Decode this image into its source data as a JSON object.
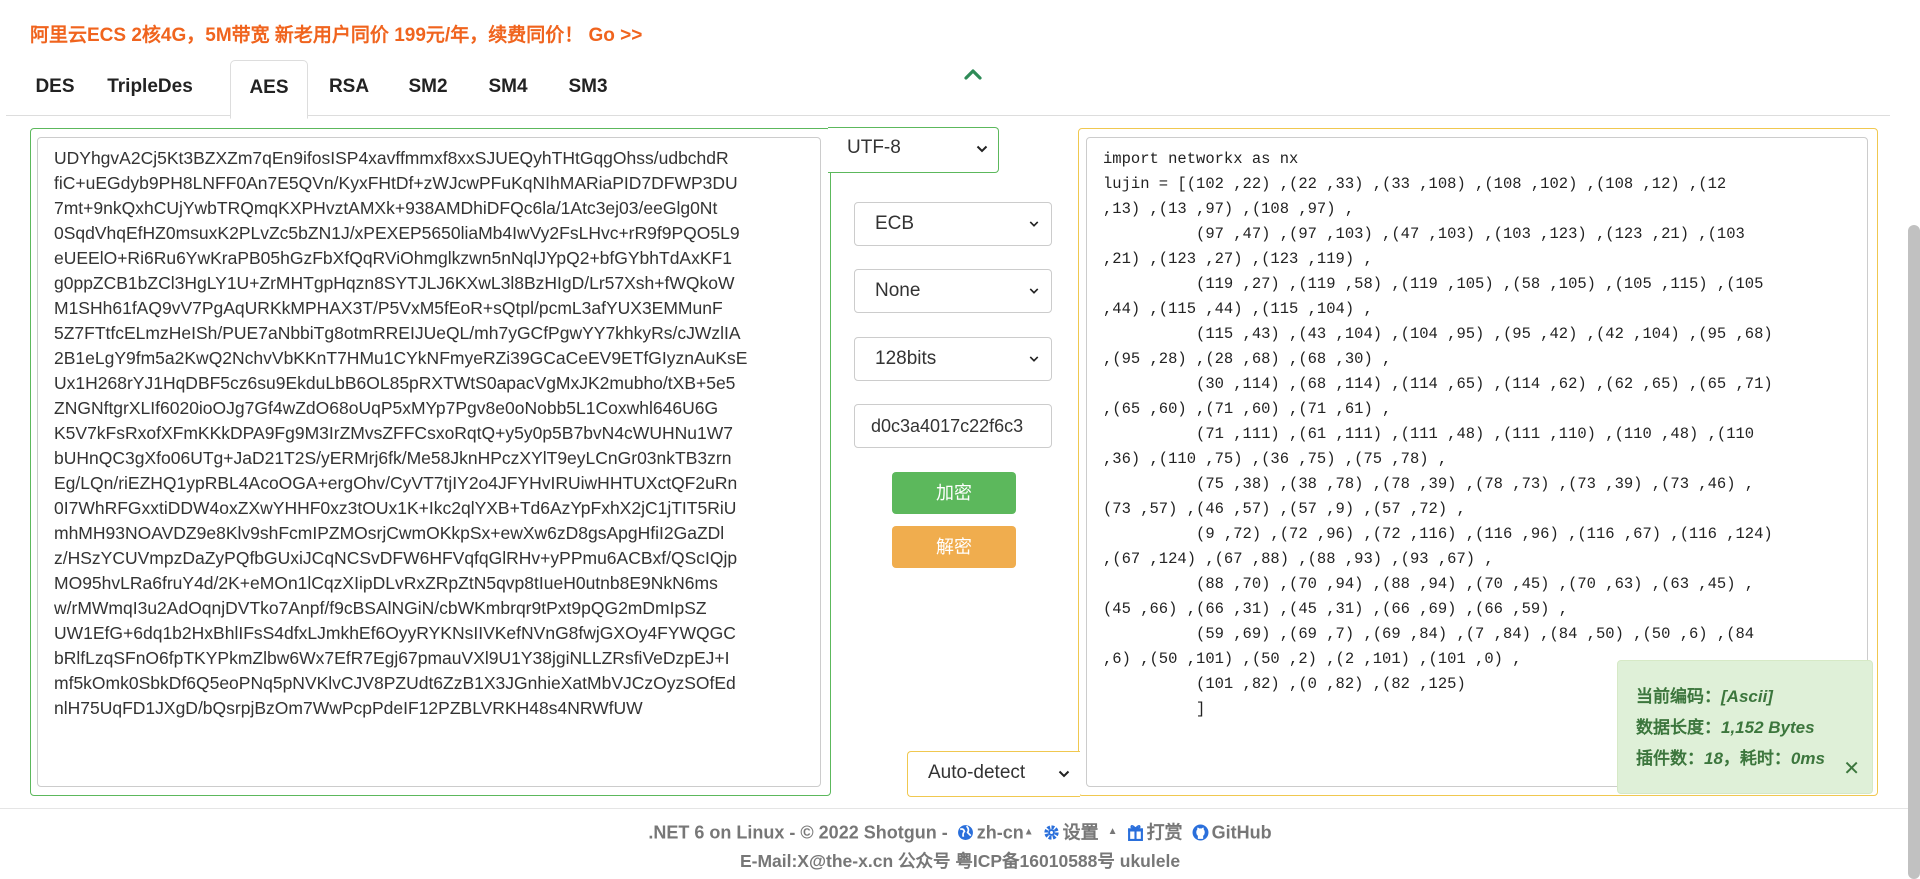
{
  "promo": {
    "text": "阿里云ECS 2核4G，5M带宽 新老用户同价 199元/年，续费同价！ Go >>"
  },
  "tabs": [
    {
      "label": "DES"
    },
    {
      "label": "TripleDes"
    },
    {
      "label": "AES"
    },
    {
      "label": "RSA"
    },
    {
      "label": "SM2"
    },
    {
      "label": "SM4"
    },
    {
      "label": "SM3"
    }
  ],
  "active_tab": "AES",
  "input": {
    "encoding": "UTF-8",
    "lines": [
      "UDYhgvA2Cj5Kt3BZXZm7qEn9ifosISP4xavffmmxf8xxSJUEQyhTHtGqgOhss/udbchdR",
      "fiC+uEGdyb9PH8LNFF0An7E5QVn/KyxFHtDf+zWJcwPFuKqNIhMARiaPID7DFWP3DU",
      "7mt+9nkQxhCUjYwbTRQmqKXPHvztAMXk+938AMDhiDFQc6la/1Atc3ej03/eeGlg0Nt",
      "0SqdVhqEfHZ0msuxK2PLvZc5bZN1J/xPEXEP5650liaMb4IwVy2FsLHvc+rR9f9PQO5L9",
      "eUEElO+Ri6Ru6YwKraPB05hGzFbXfQqRViOhmglkzwn5nNqlJYpQ2+bfGYbhTdAxKF1",
      "g0ppZCB1bZCl3HgLY1U+ZrMHTgpHqzn8SYTJLJ6KXwL3l8BzHIgD/Lr57Xsh+fWQkoW",
      "M1SHh61fAQ9vV7PgAqURKkMPHAX3T/P5VxM5fEoR+sQtpl/pcmL3afYUX3EMMunF",
      "5Z7FTtfcELmzHeISh/PUE7aNbbiTg8otmRREIJUeQL/mh7yGCfPgwYY7khkyRs/cJWzlIA",
      "2B1eLgY9fm5a2KwQ2NchvVbKKnT7HMu1CYkNFmyeRZi39GCaCeEV9ETfGIyznAuKsE",
      "Ux1H268rYJ1HqDBF5cz6su9EkduLbB6OL85pRXTWtS0apacVgMxJK2mubho/tXB+5e5",
      "ZNGNftgrXLIf6020ioOJg7Gf4wZdO68oUqP5xMYp7Pgv8e0oNobb5L1Coxwhl646U6G",
      "K5V7kFsRxofXFmKKkDPA9Fg9M3IrZMvsZFFCsxoRqtQ+y5y0p5B7bvN4cWUHNu1W7",
      "bUHnQC3gXfo06UTg+JaD21T2S/yERMrj6fk/Me58JknHPczXYlT9eyLCnGr03nkTB3zrn",
      "Eg/LQn/riEZHQ1ypRBL4AcoOGA+ergOhv/CyVT7tjIY2o4JFYHvIRUiwHHTUXctQF2uRn",
      "0I7WhRFGxxtiDDW4oxZXwYHHF0xz3tOUx1K+Ikc2qlYXB+Td6AzYpFxhX2jC1jTIT5RiU",
      "mhMH93NOAVDZ9e8Klv9shFcmIPZMOsrjCwmOKkpSx+ewXw6zD8gsApgHfiI2GaZDl",
      "z/HSzYCUVmpzDaZyPQfbGUxiJCqNCSvDFW6HFVqfqGlRHv+yPPmu6ACBxf/QScIQjp",
      "MO95hvLRa6fruY4d/2K+eMOn1lCqzXIipDLvRxZRpZtN5qvp8tIueH0utnb8E9NkN6ms",
      "w/rMWmqI3u2AdOqnjDVTko7Anpf/f9cBSAlNGiN/cbWKmbrqr9tPxt9pQG2mDmIpSZ",
      "UW1EfG+6dq1b2HxBhlIFsS4dfxLJmkhEf6OyyRYKNsIIVKefNVnG8fwjGXOy4FYWQGC",
      "bRlfLzqSFnO6fpTKYPkmZlbw6Wx7EfR7Egj67pmauVXl9U1Y38jgiNLLZRsfiVeDzpEJ+I",
      "mf5kOmk0SbkDf6Q5eoPNq5pNVKlvCJV8PZUdt6ZzB1X3JGnhieXatMbVJCzOyzSOfEd",
      "nlH75UqFD1JXgD/bQsrpjBzOm7WwPcpPdeIF12PZBLVRKH48s4NRWfUW"
    ]
  },
  "controls": {
    "mode": "ECB",
    "padding": "None",
    "keysize": "128bits",
    "key": "d0c3a4017c22f6c3",
    "encrypt_label": "加密",
    "decrypt_label": "解密"
  },
  "output": {
    "detect": "Auto-detect",
    "lines": [
      "import networkx as nx",
      "lujin = [(102 ,22) ,(22 ,33) ,(33 ,108) ,(108 ,102) ,(108 ,12) ,(12",
      ",13) ,(13 ,97) ,(108 ,97) ,",
      "          (97 ,47) ,(97 ,103) ,(47 ,103) ,(103 ,123) ,(123 ,21) ,(103",
      ",21) ,(123 ,27) ,(123 ,119) ,",
      "          (119 ,27) ,(119 ,58) ,(119 ,105) ,(58 ,105) ,(105 ,115) ,(105",
      ",44) ,(115 ,44) ,(115 ,104) ,",
      "          (115 ,43) ,(43 ,104) ,(104 ,95) ,(95 ,42) ,(42 ,104) ,(95 ,68)",
      ",(95 ,28) ,(28 ,68) ,(68 ,30) ,",
      "          (30 ,114) ,(68 ,114) ,(114 ,65) ,(114 ,62) ,(62 ,65) ,(65 ,71)",
      ",(65 ,60) ,(71 ,60) ,(71 ,61) ,",
      "          (71 ,111) ,(61 ,111) ,(111 ,48) ,(111 ,110) ,(110 ,48) ,(110",
      ",36) ,(110 ,75) ,(36 ,75) ,(75 ,78) ,",
      "          (75 ,38) ,(38 ,78) ,(78 ,39) ,(78 ,73) ,(73 ,39) ,(73 ,46) ,",
      "(73 ,57) ,(46 ,57) ,(57 ,9) ,(57 ,72) ,",
      "          (9 ,72) ,(72 ,96) ,(72 ,116) ,(116 ,96) ,(116 ,67) ,(116 ,124)",
      ",(67 ,124) ,(67 ,88) ,(88 ,93) ,(93 ,67) ,",
      "          (88 ,70) ,(70 ,94) ,(88 ,94) ,(70 ,45) ,(70 ,63) ,(63 ,45) ,",
      "(45 ,66) ,(66 ,31) ,(45 ,31) ,(66 ,69) ,(66 ,59) ,",
      "          (59 ,69) ,(69 ,7) ,(69 ,84) ,(7 ,84) ,(84 ,50) ,(50 ,6) ,(84",
      ",6) ,(50 ,101) ,(50 ,2) ,(2 ,101) ,(101 ,0) ,",
      "          (101 ,82) ,(0 ,82) ,(82 ,125)",
      "          ]"
    ]
  },
  "status": {
    "encoding_label": "当前编码：",
    "encoding_value": "[Ascii]",
    "length_label": "数据长度：",
    "length_value": "1,152 Bytes",
    "plugins_label": "插件数：",
    "plugins_value": "18",
    "time_label": "，耗时：",
    "time_value": "0ms",
    "close": "✕"
  },
  "footer": {
    "platform": ".NET 6 on Linux - © 2022 Shotgun -",
    "lang": "zh-cn",
    "settings": "设置",
    "donate": "打赏",
    "github": "GitHub",
    "line2": "E-Mail:X@the-x.cn 公众号 粤ICP备16010588号 ukulele"
  },
  "colors": {
    "promo": "#f0641e",
    "left_border": "#5cb85c",
    "right_border": "#f0c850",
    "encrypt": "#5cb85c",
    "decrypt": "#f0ad4e",
    "status_bg": "#dff0d8",
    "status_text": "#3c763d",
    "link_blue": "#2a6fdb"
  }
}
